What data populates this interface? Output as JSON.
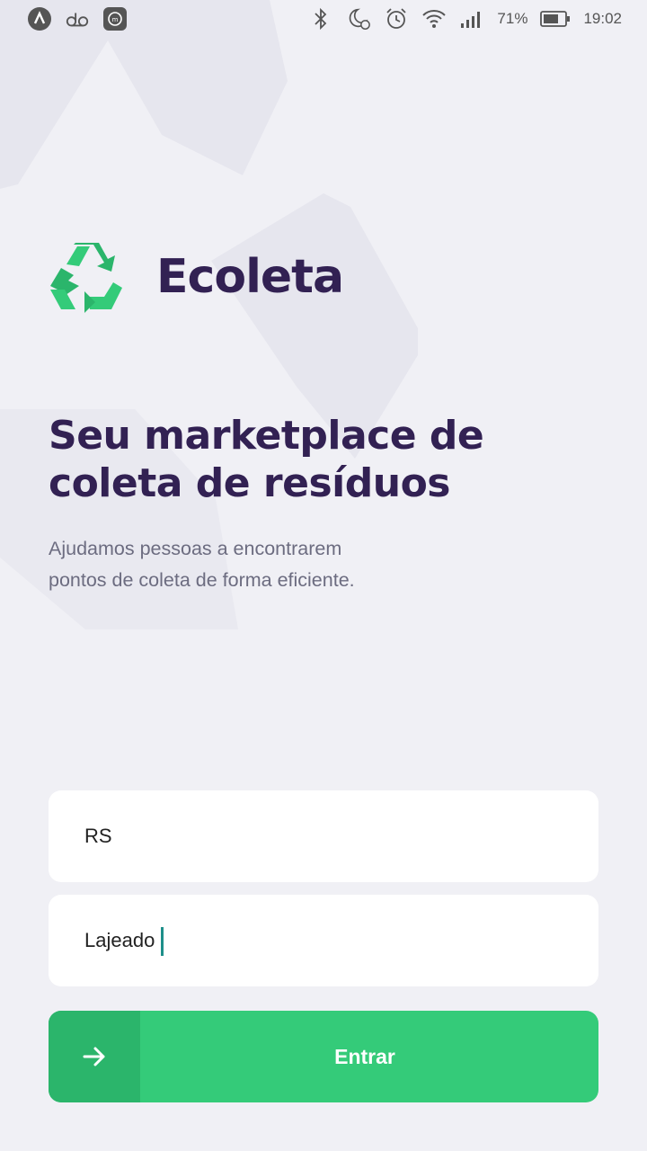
{
  "status_bar": {
    "battery_percent": "71%",
    "time": "19:02",
    "left_icons": [
      "app-icon",
      "voicemail-icon",
      "media-icon"
    ],
    "right_icons": [
      "bluetooth-icon",
      "do-not-disturb-icon",
      "alarm-icon",
      "wifi-icon",
      "signal-icon",
      "battery-icon"
    ]
  },
  "app": {
    "name": "Ecoleta",
    "logo_icon": "recycle-icon",
    "brand_colors": {
      "primary_text": "#322153",
      "green": "#34CB79",
      "green_dark": "#2BB56B",
      "subtitle": "#6C6C80",
      "background": "#F0F0F5"
    }
  },
  "hero": {
    "headline_line1": "Seu marketplace de",
    "headline_line2": "coleta de resíduos",
    "subtitle_line1": "Ajudamos pessoas a encontrarem",
    "subtitle_line2": "pontos de coleta de forma eficiente."
  },
  "form": {
    "uf_value": "RS",
    "city_value": "Lajeado"
  },
  "submit": {
    "label": "Entrar",
    "icon": "arrow-right-icon"
  }
}
